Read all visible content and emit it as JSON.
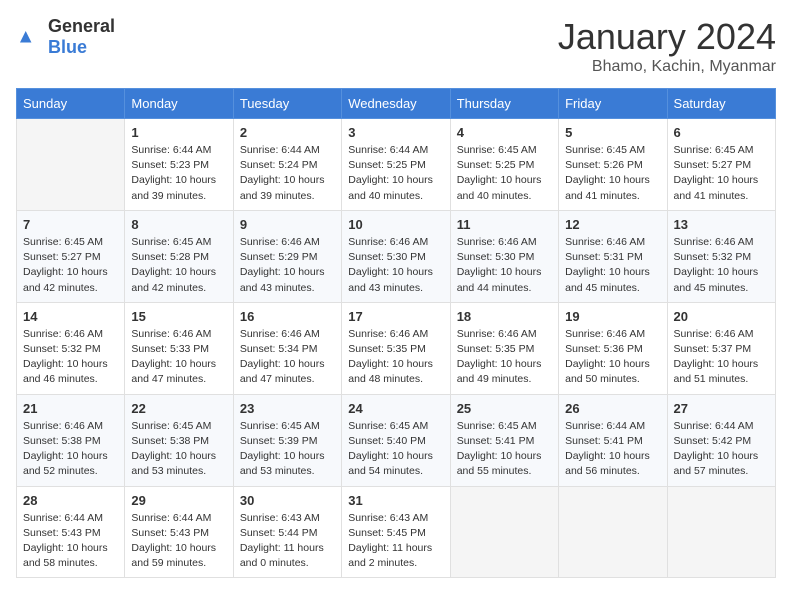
{
  "header": {
    "logo_general": "General",
    "logo_blue": "Blue",
    "month_title": "January 2024",
    "location": "Bhamo, Kachin, Myanmar"
  },
  "weekdays": [
    "Sunday",
    "Monday",
    "Tuesday",
    "Wednesday",
    "Thursday",
    "Friday",
    "Saturday"
  ],
  "weeks": [
    [
      {
        "day": "",
        "info": ""
      },
      {
        "day": "1",
        "info": "Sunrise: 6:44 AM\nSunset: 5:23 PM\nDaylight: 10 hours\nand 39 minutes."
      },
      {
        "day": "2",
        "info": "Sunrise: 6:44 AM\nSunset: 5:24 PM\nDaylight: 10 hours\nand 39 minutes."
      },
      {
        "day": "3",
        "info": "Sunrise: 6:44 AM\nSunset: 5:25 PM\nDaylight: 10 hours\nand 40 minutes."
      },
      {
        "day": "4",
        "info": "Sunrise: 6:45 AM\nSunset: 5:25 PM\nDaylight: 10 hours\nand 40 minutes."
      },
      {
        "day": "5",
        "info": "Sunrise: 6:45 AM\nSunset: 5:26 PM\nDaylight: 10 hours\nand 41 minutes."
      },
      {
        "day": "6",
        "info": "Sunrise: 6:45 AM\nSunset: 5:27 PM\nDaylight: 10 hours\nand 41 minutes."
      }
    ],
    [
      {
        "day": "7",
        "info": "Sunrise: 6:45 AM\nSunset: 5:27 PM\nDaylight: 10 hours\nand 42 minutes."
      },
      {
        "day": "8",
        "info": "Sunrise: 6:45 AM\nSunset: 5:28 PM\nDaylight: 10 hours\nand 42 minutes."
      },
      {
        "day": "9",
        "info": "Sunrise: 6:46 AM\nSunset: 5:29 PM\nDaylight: 10 hours\nand 43 minutes."
      },
      {
        "day": "10",
        "info": "Sunrise: 6:46 AM\nSunset: 5:30 PM\nDaylight: 10 hours\nand 43 minutes."
      },
      {
        "day": "11",
        "info": "Sunrise: 6:46 AM\nSunset: 5:30 PM\nDaylight: 10 hours\nand 44 minutes."
      },
      {
        "day": "12",
        "info": "Sunrise: 6:46 AM\nSunset: 5:31 PM\nDaylight: 10 hours\nand 45 minutes."
      },
      {
        "day": "13",
        "info": "Sunrise: 6:46 AM\nSunset: 5:32 PM\nDaylight: 10 hours\nand 45 minutes."
      }
    ],
    [
      {
        "day": "14",
        "info": "Sunrise: 6:46 AM\nSunset: 5:32 PM\nDaylight: 10 hours\nand 46 minutes."
      },
      {
        "day": "15",
        "info": "Sunrise: 6:46 AM\nSunset: 5:33 PM\nDaylight: 10 hours\nand 47 minutes."
      },
      {
        "day": "16",
        "info": "Sunrise: 6:46 AM\nSunset: 5:34 PM\nDaylight: 10 hours\nand 47 minutes."
      },
      {
        "day": "17",
        "info": "Sunrise: 6:46 AM\nSunset: 5:35 PM\nDaylight: 10 hours\nand 48 minutes."
      },
      {
        "day": "18",
        "info": "Sunrise: 6:46 AM\nSunset: 5:35 PM\nDaylight: 10 hours\nand 49 minutes."
      },
      {
        "day": "19",
        "info": "Sunrise: 6:46 AM\nSunset: 5:36 PM\nDaylight: 10 hours\nand 50 minutes."
      },
      {
        "day": "20",
        "info": "Sunrise: 6:46 AM\nSunset: 5:37 PM\nDaylight: 10 hours\nand 51 minutes."
      }
    ],
    [
      {
        "day": "21",
        "info": "Sunrise: 6:46 AM\nSunset: 5:38 PM\nDaylight: 10 hours\nand 52 minutes."
      },
      {
        "day": "22",
        "info": "Sunrise: 6:45 AM\nSunset: 5:38 PM\nDaylight: 10 hours\nand 53 minutes."
      },
      {
        "day": "23",
        "info": "Sunrise: 6:45 AM\nSunset: 5:39 PM\nDaylight: 10 hours\nand 53 minutes."
      },
      {
        "day": "24",
        "info": "Sunrise: 6:45 AM\nSunset: 5:40 PM\nDaylight: 10 hours\nand 54 minutes."
      },
      {
        "day": "25",
        "info": "Sunrise: 6:45 AM\nSunset: 5:41 PM\nDaylight: 10 hours\nand 55 minutes."
      },
      {
        "day": "26",
        "info": "Sunrise: 6:44 AM\nSunset: 5:41 PM\nDaylight: 10 hours\nand 56 minutes."
      },
      {
        "day": "27",
        "info": "Sunrise: 6:44 AM\nSunset: 5:42 PM\nDaylight: 10 hours\nand 57 minutes."
      }
    ],
    [
      {
        "day": "28",
        "info": "Sunrise: 6:44 AM\nSunset: 5:43 PM\nDaylight: 10 hours\nand 58 minutes."
      },
      {
        "day": "29",
        "info": "Sunrise: 6:44 AM\nSunset: 5:43 PM\nDaylight: 10 hours\nand 59 minutes."
      },
      {
        "day": "30",
        "info": "Sunrise: 6:43 AM\nSunset: 5:44 PM\nDaylight: 11 hours\nand 0 minutes."
      },
      {
        "day": "31",
        "info": "Sunrise: 6:43 AM\nSunset: 5:45 PM\nDaylight: 11 hours\nand 2 minutes."
      },
      {
        "day": "",
        "info": ""
      },
      {
        "day": "",
        "info": ""
      },
      {
        "day": "",
        "info": ""
      }
    ]
  ]
}
